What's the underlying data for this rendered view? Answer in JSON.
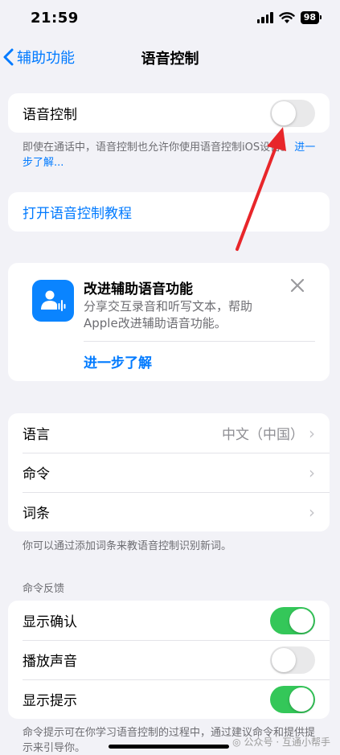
{
  "status": {
    "time": "21:59",
    "battery": "98"
  },
  "nav": {
    "back_label": "辅助功能",
    "title": "语音控制"
  },
  "voice_control": {
    "label": "语音控制",
    "enabled": false
  },
  "voice_control_note": {
    "text": "即使在通话中，语音控制也允许你使用语音控制iOS设备。",
    "link": "进一步了解..."
  },
  "tutorial": {
    "label": "打开语音控制教程"
  },
  "improve_card": {
    "title": "改进辅助语音功能",
    "text": "分享交互录音和听写文本，帮助Apple改进辅助语音功能。",
    "link": "进一步了解"
  },
  "settings": {
    "language_label": "语言",
    "language_value": "中文（中国）",
    "commands_label": "命令",
    "vocabulary_label": "词条"
  },
  "vocabulary_note": "你可以通过添加词条来教语音控制识别新词。",
  "feedback": {
    "header": "命令反馈",
    "show_confirmation": {
      "label": "显示确认",
      "enabled": true
    },
    "play_sound": {
      "label": "播放声音",
      "enabled": false
    },
    "show_hints": {
      "label": "显示提示",
      "enabled": true
    }
  },
  "hints_note": "命令提示可在你学习语音控制的过程中，通过建议命令和提供提示来引导你。",
  "watermark": "公众号 · 互通小帮手",
  "colors": {
    "accent": "#007aff",
    "toggle_on": "#34c759",
    "arrow": "#e8262a"
  }
}
